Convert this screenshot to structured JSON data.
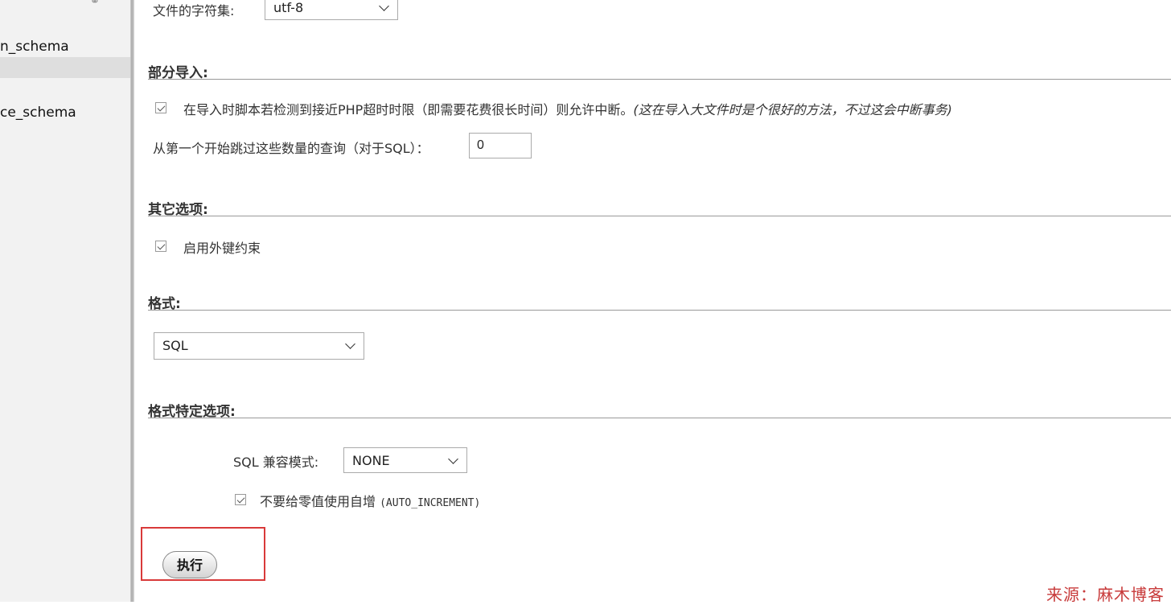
{
  "sidebar": {
    "items": [
      {
        "label": "n_schema"
      },
      {
        "label": "ce_schema"
      }
    ]
  },
  "charset": {
    "label": "文件的字符集:",
    "value": "utf-8"
  },
  "partial_import": {
    "title": "部分导入:",
    "allow_interrupt_label": "在导入时脚本若检测到接近PHP超时时限（即需要花费很长时间）则允许中断。",
    "allow_interrupt_hint": "(这在导入大文件时是个很好的方法，不过这会中断事务)",
    "skip_queries_label": "从第一个开始跳过这些数量的查询（对于SQL）：",
    "skip_queries_value": "0"
  },
  "other_options": {
    "title": "其它选项:",
    "foreign_keys_label": "启用外键约束"
  },
  "format": {
    "title": "格式:",
    "value": "SQL"
  },
  "format_options": {
    "title": "格式特定选项:",
    "compat_label": "SQL 兼容模式:",
    "compat_value": "NONE",
    "no_auto_value_label": "不要给零值使用自增",
    "no_auto_value_code": "(AUTO_INCREMENT)"
  },
  "go_button_label": "执行",
  "watermark": "来源：麻木博客"
}
